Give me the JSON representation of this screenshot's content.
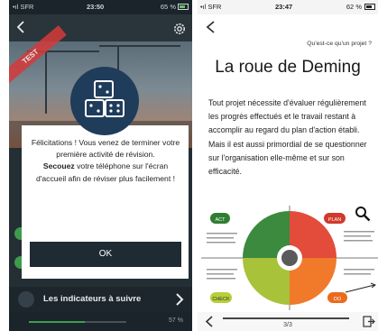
{
  "left": {
    "status": {
      "carrier": "•ıl SFR",
      "time": "23:50",
      "battery": "65 %"
    },
    "ribbon": "TEST",
    "modal": {
      "line1": "Félicitations ! Vous venez de terminer votre première activité de révision.",
      "bold": "Secouez",
      "line2": " votre téléphone sur l'écran d'accueil afin de réviser plus facilement !",
      "ok_label": "OK"
    },
    "bottom_item": "Les indicateurs à suivre",
    "progress": {
      "value": 0.57,
      "label": "57 %"
    },
    "colors": {
      "accent": "#3f9d4e",
      "dark": "#1e2b33",
      "icon_bg": "#1f3c5b"
    }
  },
  "right": {
    "status": {
      "carrier": "•ıl SFR",
      "time": "23:47",
      "battery": "62 %"
    },
    "question_link": "Qu'est-ce qu'un projet ?",
    "title": "La roue de Deming",
    "paragraph": "Tout projet nécessite d'évaluer régulièrement les progrès effectués et le travail restant à accomplir au regard du plan d'action établi. Mais il est aussi primordial de se questionner sur l'organisation elle-même et sur son efficacité.",
    "figure": {
      "act": "ACT",
      "plan": "PLAN",
      "check": "CHECK",
      "do": "DO"
    },
    "pager": {
      "label": "3/3",
      "value": 1.0
    }
  }
}
